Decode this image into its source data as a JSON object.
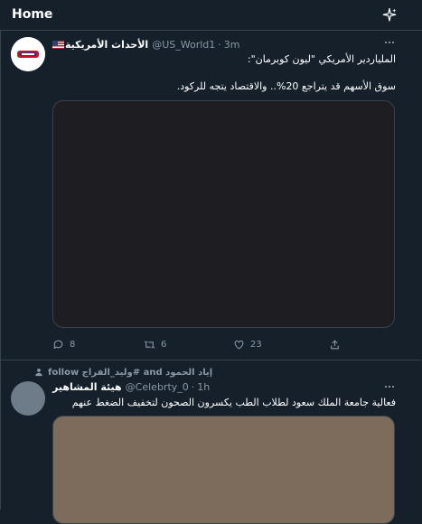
{
  "header": {
    "title": "Home",
    "sparkle_icon": "sparkle-icon"
  },
  "tweets": [
    {
      "author_name": "الأحداث الأمريكية",
      "handle": "@US_World1",
      "separator": "·",
      "time": "3m",
      "text_line1": "الملياردير الأمريكي \"ليون كوبرمان\":",
      "text_line2": "سوق الأسهم قد يتراجع 20%.. والاقتصاد يتجه للركود.",
      "actions": {
        "replies": "8",
        "retweets": "6",
        "likes": "23"
      }
    },
    {
      "retweeted_by": "إياد الحمود and #وليد_الفراج follow",
      "author_name": "هيئة المشاهير",
      "handle": "@Celebrty_0",
      "separator": "·",
      "time": "1h",
      "text_line1": "فعالية جامعة الملك سعود لطلاب الطب يكسرون الصحون لتخفيف الضغط عنهم"
    }
  ],
  "colors": {
    "background": "#15202b",
    "border": "#38444d",
    "muted_text": "#8b98a5",
    "text": "#ffffff"
  }
}
